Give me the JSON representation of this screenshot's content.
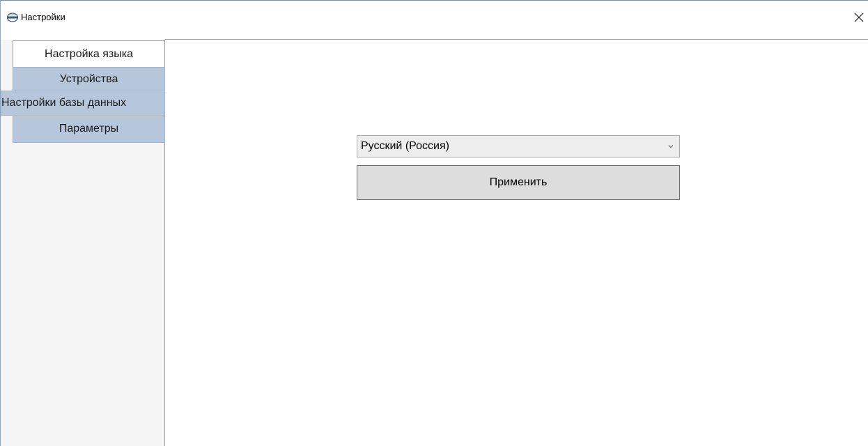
{
  "window": {
    "title": "Настройки",
    "icon": "app-logo-icon",
    "close_icon": "close-icon"
  },
  "tabs": [
    {
      "label": "Настройка языка",
      "active": true
    },
    {
      "label": "Устройства",
      "active": false
    },
    {
      "label": "Настройки базы данных",
      "active": false
    },
    {
      "label": "Параметры",
      "active": false
    }
  ],
  "language": {
    "selected": "Русский (Россия)",
    "dropdown_icon": "chevron-down-icon",
    "apply_label": "Применить"
  },
  "colors": {
    "inactive_tab": "#b6c7dc",
    "button": "#dddddd",
    "select": "#ededed"
  }
}
